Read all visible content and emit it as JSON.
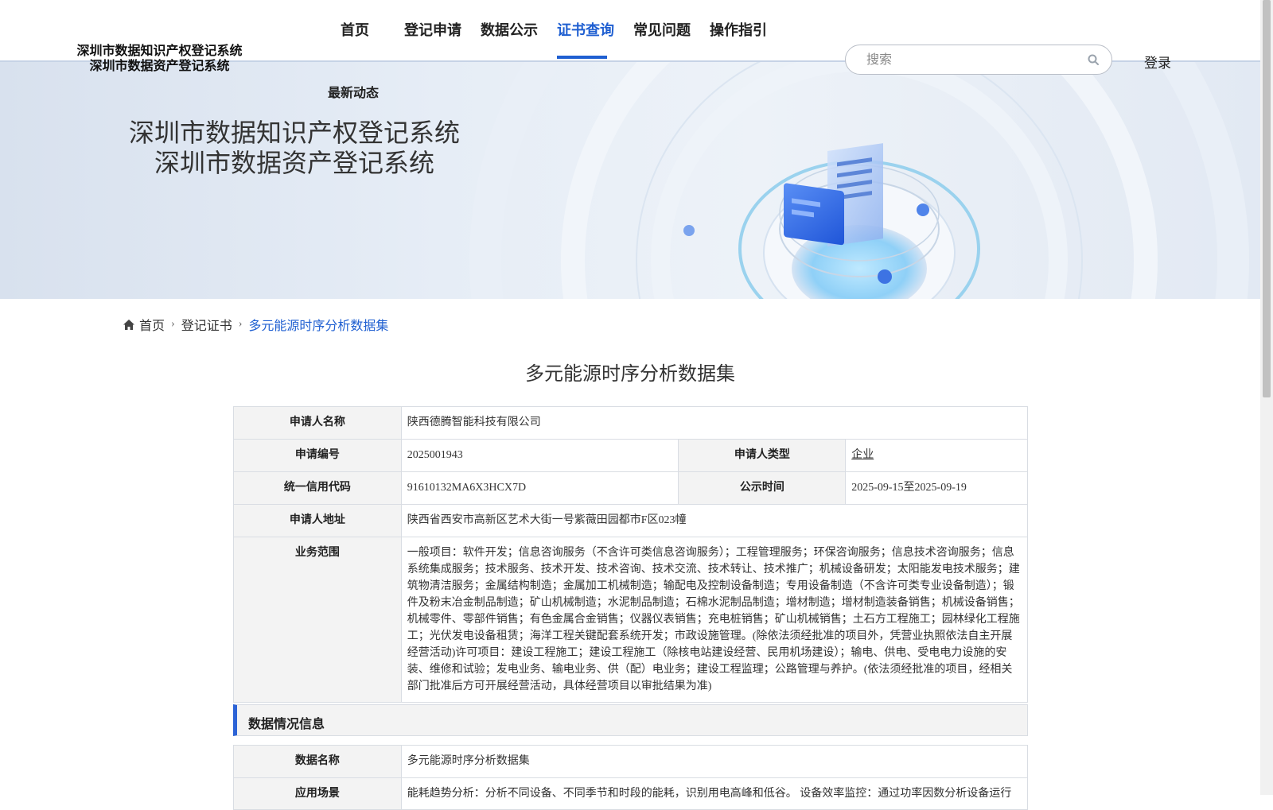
{
  "header": {
    "logo_line1": "深圳市数据知识产权登记系统",
    "logo_line2": "深圳市数据资产登记系统",
    "nav": [
      "首页",
      "登记申请",
      "数据公示",
      "证书查询",
      "常见问题",
      "操作指引"
    ],
    "nav_sub": "最新动态",
    "active_nav": "证书查询",
    "search_placeholder": "搜索",
    "login_label": "登录",
    "accent_color": "#1f5fd1"
  },
  "banner": {
    "title_line1": "深圳市数据知识产权登记系统",
    "title_line2": "深圳市数据资产登记系统"
  },
  "breadcrumb": {
    "home": "首页",
    "level2": "登记证书",
    "current": "多元能源时序分析数据集"
  },
  "page_title": "多元能源时序分析数据集",
  "applicant": {
    "name_label": "申请人名称",
    "name_value": "陕西德腾智能科技有限公司",
    "no_label": "申请编号",
    "no_value": "2025001943",
    "type_label": "申请人类型",
    "type_value": "企业",
    "credit_label": "统一信用代码",
    "credit_value": "91610132MA6X3HCX7D",
    "pub_label": "公示时间",
    "pub_value": "2025-09-15至2025-09-19",
    "addr_label": "申请人地址",
    "addr_value": "陕西省西安市高新区艺术大街一号紫薇田园都市F区023幢",
    "scope_label": "业务范围",
    "scope_value": "一般项目：软件开发；信息咨询服务（不含许可类信息咨询服务）；工程管理服务；环保咨询服务；信息技术咨询服务；信息系统集成服务；技术服务、技术开发、技术咨询、技术交流、技术转让、技术推广；机械设备研发；太阳能发电技术服务；建筑物清洁服务；金属结构制造；金属加工机械制造；输配电及控制设备制造；专用设备制造（不含许可类专业设备制造）；锻件及粉末冶金制品制造；矿山机械制造；水泥制品制造；石棉水泥制品制造；增材制造；增材制造装备销售；机械设备销售；机械零件、零部件销售；有色金属合金销售；仪器仪表销售；充电桩销售；矿山机械销售；土石方工程施工；园林绿化工程施工；光伏发电设备租赁；海洋工程关键配套系统开发；市政设施管理。(除依法须经批准的项目外，凭营业执照依法自主开展经营活动)许可项目：建设工程施工；建设工程施工（除核电站建设经营、民用机场建设）；输电、供电、受电电力设施的安装、维修和试验；发电业务、输电业务、供（配）电业务；建设工程监理；公路管理与养护。(依法须经批准的项目，经相关部门批准后方可开展经营活动，具体经营项目以审批结果为准)"
  },
  "data_section": {
    "title": "数据情况信息",
    "name_label": "数据名称",
    "name_value": "多元能源时序分析数据集",
    "scene_label": "应用场景",
    "scene_value": "能耗趋势分析：分析不同设备、不同季节和时段的能耗，识别用电高峰和低谷。 设备效率监控：通过功率因数分析设备运行"
  }
}
